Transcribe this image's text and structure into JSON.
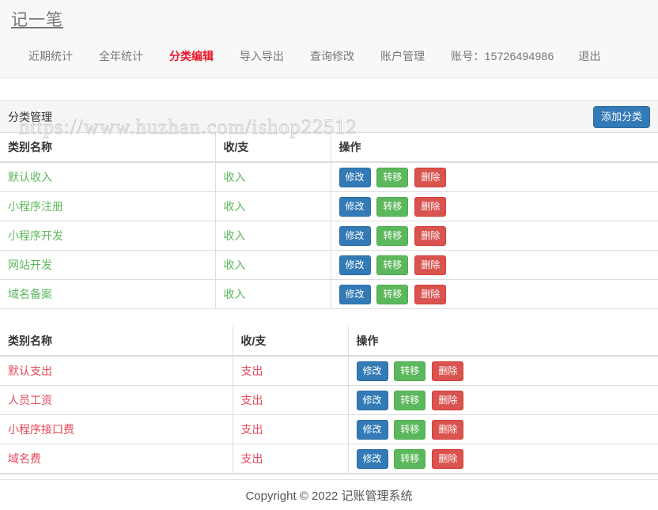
{
  "navbar": {
    "brand": "记一笔",
    "items": [
      {
        "label": "近期统计",
        "active": false
      },
      {
        "label": "全年统计",
        "active": false
      },
      {
        "label": "分类编辑",
        "active": true
      },
      {
        "label": "导入导出",
        "active": false
      },
      {
        "label": "查询修改",
        "active": false
      },
      {
        "label": "账户管理",
        "active": false
      },
      {
        "label": "账号：15726494986",
        "active": false
      },
      {
        "label": "退出",
        "active": false
      }
    ]
  },
  "panel": {
    "title": "分类管理",
    "add_button": "添加分类"
  },
  "watermark": "https://www.huzhan.com/ishop22512",
  "tables": [
    {
      "id": "income",
      "headers": [
        "类别名称",
        "收/支",
        "操作"
      ],
      "rows": [
        {
          "name": "默认收入",
          "type": "收入"
        },
        {
          "name": "小程序注册",
          "type": "收入"
        },
        {
          "name": "小程序开发",
          "type": "收入"
        },
        {
          "name": "网站开发",
          "type": "收入"
        },
        {
          "name": "域名备案",
          "type": "收入"
        }
      ]
    },
    {
      "id": "expense",
      "headers": [
        "类别名称",
        "收/支",
        "操作"
      ],
      "rows": [
        {
          "name": "默认支出",
          "type": "支出"
        },
        {
          "name": "人员工资",
          "type": "支出"
        },
        {
          "name": "小程序接口费",
          "type": "支出"
        },
        {
          "name": "域名费",
          "type": "支出"
        }
      ]
    }
  ],
  "row_actions": {
    "edit": "修改",
    "move": "转移",
    "delete": "删除"
  },
  "footer": {
    "text": "Copyright © 2022 记账管理系统"
  },
  "colors": {
    "brand_blue": "#337ab7",
    "success_green": "#5cb85c",
    "danger_red": "#d9534f",
    "active_nav_red": "#e8162a",
    "income_text": "#5cb85c",
    "expense_text": "#e8485a"
  }
}
